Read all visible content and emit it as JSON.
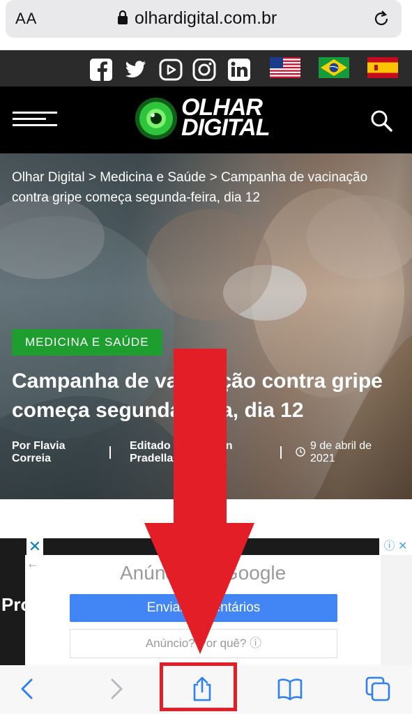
{
  "browser": {
    "text_size_label": "AA",
    "url": "olhardigital.com.br"
  },
  "social": {
    "icons": [
      "facebook-icon",
      "twitter-icon",
      "youtube-icon",
      "instagram-icon",
      "linkedin-icon"
    ],
    "flags": [
      "usa-flag",
      "brazil-flag",
      "spain-flag"
    ]
  },
  "site": {
    "logo_line1": "OLHAR",
    "logo_line2": "DIGITAL"
  },
  "article": {
    "breadcrumb": "Olhar Digital > Medicina e Saúde > Campanha de vacinação contra gripe começa segunda-feira, dia 12",
    "category": "MEDICINA E SAÚDE",
    "headline": "Campanha de vacinação contra gripe começa segunda-feira, dia 12",
    "author_line1": "Por Flavia",
    "author_line2": "Correia",
    "editor_line1": "Editado por Rincon",
    "editor_line2": "Pradella",
    "date_line1": "9 de abril de",
    "date_line2": "2021"
  },
  "ad": {
    "title": "Anúncio do Google",
    "send_button": "Enviar comentários",
    "why_link": "Anúncio? Por quê? ⓘ",
    "close_label": "✕",
    "info_label": "ⓘ ✕",
    "brand_text": "Pro"
  },
  "toolbar": {
    "icons": [
      "back-icon",
      "forward-icon",
      "share-icon",
      "bookmarks-icon",
      "tabs-icon"
    ]
  },
  "colors": {
    "category_green": "#1e9e2f",
    "annotation_red": "#e41e26",
    "ios_blue": "#2f7ff6"
  }
}
